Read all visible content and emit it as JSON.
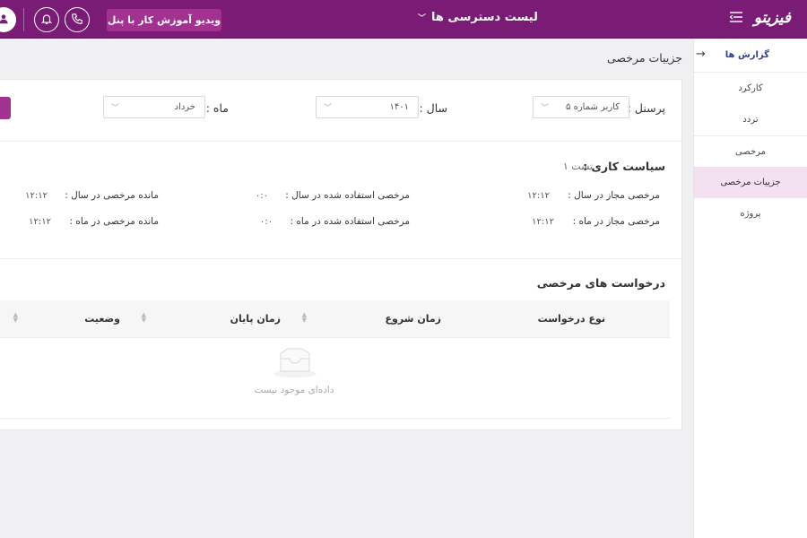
{
  "header": {
    "logo": "فیزیتو",
    "access_list": "لیست دسترسی ها",
    "video_button": "ویدیو آموزش کار با پنل",
    "colors": {
      "bar": "#7a1c75",
      "accent": "#a2328f"
    }
  },
  "sidebar": {
    "title": "گزارش ها",
    "items": [
      {
        "label": "کارکرد"
      },
      {
        "label": "تردد"
      },
      {
        "label": "مرخصی"
      },
      {
        "label": "جزییات مرخصی",
        "active": true
      },
      {
        "label": "پروژه"
      }
    ]
  },
  "page": {
    "title": "جزییات مرخصی"
  },
  "filters": {
    "personnel_label": "پرسنل :",
    "personnel_value": "کاربر شماره ۵",
    "year_label": "سال :",
    "year_value": "۱۴۰۱",
    "month_label": "ماه :",
    "month_value": "خرداد"
  },
  "policy": {
    "label": "سیاست کاری :",
    "name": "تست ۱",
    "rows": [
      {
        "allowed_label": "مرخصی مجاز در سال :",
        "allowed_value": "۱۲:۱۲",
        "used_label": "مرخصی استفاده شده در سال :",
        "used_value": "۰:۰",
        "remaining_label": "مانده مرخصی در سال :",
        "remaining_value": "۱۲:۱۲"
      },
      {
        "allowed_label": "مرخصی مجاز در ماه :",
        "allowed_value": "۱۲:۱۲",
        "used_label": "مرخصی استفاده شده در ماه :",
        "used_value": "۰:۰",
        "remaining_label": "مانده مرخصی در ماه :",
        "remaining_value": "۱۲:۱۲"
      }
    ]
  },
  "requests": {
    "title": "درخواست های مرخصی",
    "columns": [
      "نوع درخواست",
      "زمان شروع",
      "زمان پایان",
      "وضعیت"
    ],
    "empty_text": "داده‌ای موجود نیست"
  }
}
